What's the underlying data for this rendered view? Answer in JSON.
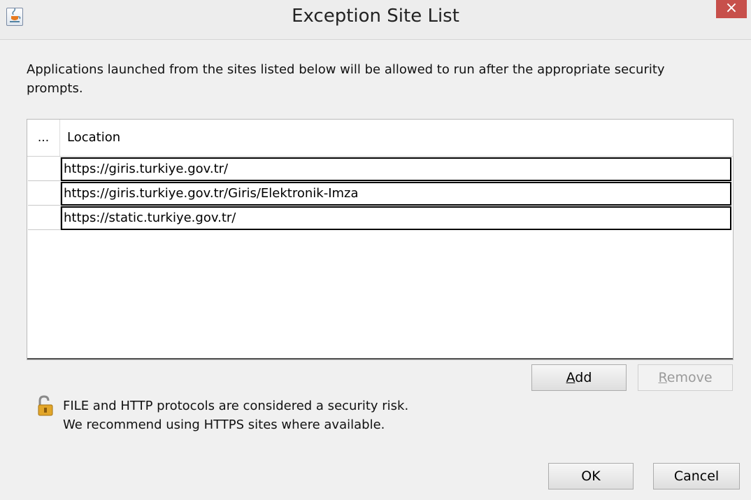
{
  "window": {
    "title": "Exception Site List",
    "close_glyph": "×",
    "app_icon": "java-cup-icon"
  },
  "intro_text": "Applications launched from the sites listed below will be allowed to run after the appropriate security prompts.",
  "table": {
    "headers": [
      "...",
      "Location"
    ],
    "rows": [
      {
        "location": "https://giris.turkiye.gov.tr/"
      },
      {
        "location": "https://giris.turkiye.gov.tr/Giris/Elektronik-Imza"
      },
      {
        "location": "https://static.turkiye.gov.tr/"
      }
    ]
  },
  "buttons": {
    "add": {
      "mnemonic": "A",
      "rest": "dd"
    },
    "remove": {
      "mnemonic": "R",
      "rest": "emove"
    },
    "ok": "OK",
    "cancel": "Cancel"
  },
  "warning": {
    "icon": "lock-warning-icon",
    "line1": "FILE and HTTP protocols are considered a security risk.",
    "line2": "We recommend using HTTPS sites where available."
  }
}
